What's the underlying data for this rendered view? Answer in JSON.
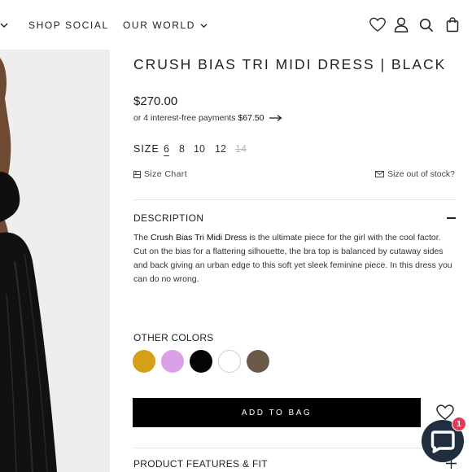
{
  "nav": {
    "items": [
      {
        "label": "SHOP SOCIAL",
        "has_dropdown": false
      },
      {
        "label": "OUR WORLD",
        "has_dropdown": true
      }
    ],
    "icons": [
      "heart-icon",
      "account-icon",
      "search-icon",
      "bag-icon"
    ]
  },
  "product": {
    "title": "CRUSH BIAS TRI MIDI DRESS | BLACK",
    "price": "$270.00",
    "installments_prefix": "or 4 interest-free payments",
    "installments_amount": "$67.50",
    "size_label": "SIZE",
    "sizes": [
      {
        "label": "6",
        "selected": true,
        "available": true
      },
      {
        "label": "8",
        "selected": false,
        "available": true
      },
      {
        "label": "10",
        "selected": false,
        "available": true
      },
      {
        "label": "12",
        "selected": false,
        "available": true
      },
      {
        "label": "14",
        "selected": false,
        "available": false
      }
    ],
    "size_chart_label": "Size Chart",
    "size_stock_label": "Size out of stock?",
    "description_heading": "DESCRIPTION",
    "description_name": "Crush Bias Tri Midi Dress",
    "description_rest": " is the ultimate piece for the girl with the cool factor. Cut on the bias for a flattering silhouette, the bra top is balanced by cutaway sides and back giving an urban edge to this soft yet sleek feminine piece. In this dress you can do no wrong.",
    "other_colors_heading": "OTHER COLORS",
    "colors": [
      {
        "name": "gold",
        "hex": "#d4a017"
      },
      {
        "name": "lilac",
        "hex": "#d9a0e8"
      },
      {
        "name": "black",
        "hex": "#050505"
      },
      {
        "name": "white",
        "hex": "#ffffff"
      },
      {
        "name": "brown",
        "hex": "#6b5a48"
      }
    ],
    "add_to_bag_label": "ADD TO BAG",
    "features_heading": "PRODUCT FEATURES & FIT"
  },
  "chat": {
    "badge_count": "1"
  },
  "colors": {
    "accent": "#000000",
    "badge": "#e23a57",
    "chat_bg": "#1f2f3f"
  }
}
